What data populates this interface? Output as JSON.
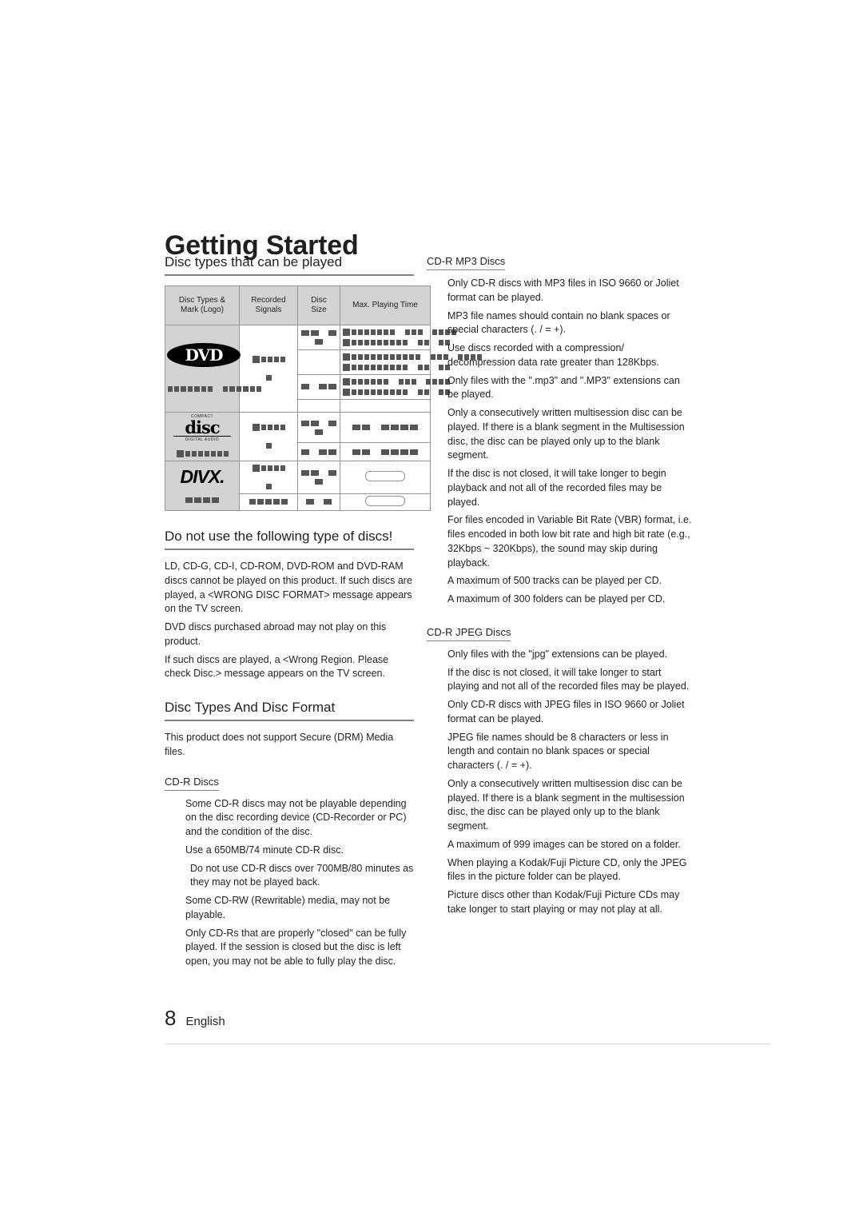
{
  "page": {
    "chapter_title": "Getting Started",
    "footer_number": "8",
    "footer_label": "English"
  },
  "left": {
    "section1_heading": "Disc types that can be played",
    "table": {
      "headers": [
        "Disc Types &\nMark (Logo)",
        "Recorded\nSignals",
        "Disc\nSize",
        "Max. Playing Time"
      ],
      "rows": [
        {
          "logo": "DVD-VIDEO",
          "logo_sub": "VIDEO"
        },
        {
          "logo": "COMPACT disc DIGITAL AUDIO"
        },
        {
          "logo": "DIVX"
        }
      ]
    },
    "section2_heading": "Do not use the following type of discs!",
    "section2_paras": [
      "LD, CD-G, CD-I, CD-ROM, DVD-ROM and DVD-RAM discs cannot be played on this product. If such discs are played, a <WRONG DISC FORMAT> message appears on the TV screen.",
      "DVD discs purchased abroad may not play on this product.",
      "If such discs are played, a <Wrong Region. Please check Disc.> message appears on the TV screen."
    ],
    "section3_heading": "Disc Types And Disc Format",
    "section3_note": "This product does not support Secure (DRM) Media files.",
    "cdr_heading": "CD-R Discs",
    "cdr_paras": [
      "Some CD-R discs may not be playable depending on the disc recording device (CD-Recorder or PC) and the condition of the disc.",
      "Use a 650MB/74 minute CD-R disc.",
      "Do not use CD-R discs over 700MB/80 minutes as they may not be played back.",
      "Some CD-RW (Rewritable) media, may not be playable.",
      "Only CD-Rs that are properly \"closed\" can be fully played. If the session is closed but the disc is left open, you may not be able to fully play the disc."
    ]
  },
  "right": {
    "mp3_heading": "CD-R MP3 Discs",
    "mp3_paras": [
      "Only CD-R discs with MP3 files in ISO 9660 or Joliet format can be played.",
      "MP3 file names should contain no blank spaces or special characters (. / = +).",
      "Use discs recorded with a compression/ decompression data rate greater than 128Kbps.",
      "Only files with the \".mp3\" and \".MP3\" extensions can be played.",
      "Only a consecutively written multisession disc can be played. If there is a blank segment in the Multisession disc, the disc can be played only up to the blank segment.",
      "If the disc is not closed, it will take longer to begin playback and not all of the recorded files may be played.",
      "For files encoded in Variable Bit Rate (VBR) format, i.e. files encoded in both low bit rate and high bit rate (e.g., 32Kbps ~ 320Kbps), the sound may skip during playback.",
      "A maximum of 500 tracks can be played per CD.",
      "A maximum of 300 folders can be played per CD."
    ],
    "jpeg_heading": "CD-R JPEG Discs",
    "jpeg_paras": [
      "Only files with the \"jpg\" extensions can be played.",
      "If the disc is not closed, it will take longer to start playing and not all of the recorded files may be played.",
      "Only CD-R discs with JPEG files in ISO 9660 or Joliet format can be played.",
      "JPEG file names should be 8 characters or less in length and contain no blank spaces or special characters (. / = +).",
      "Only a consecutively written multisession disc can be played. If there is a blank segment in the multisession disc, the disc can be played only up to the blank segment.",
      "A maximum of 999 images can be stored on a folder.",
      "When playing a Kodak/Fuji Picture CD, only the JPEG files in the picture folder can be played.",
      "Picture discs other than Kodak/Fuji Picture CDs may take longer to start playing or may not play at all."
    ]
  }
}
